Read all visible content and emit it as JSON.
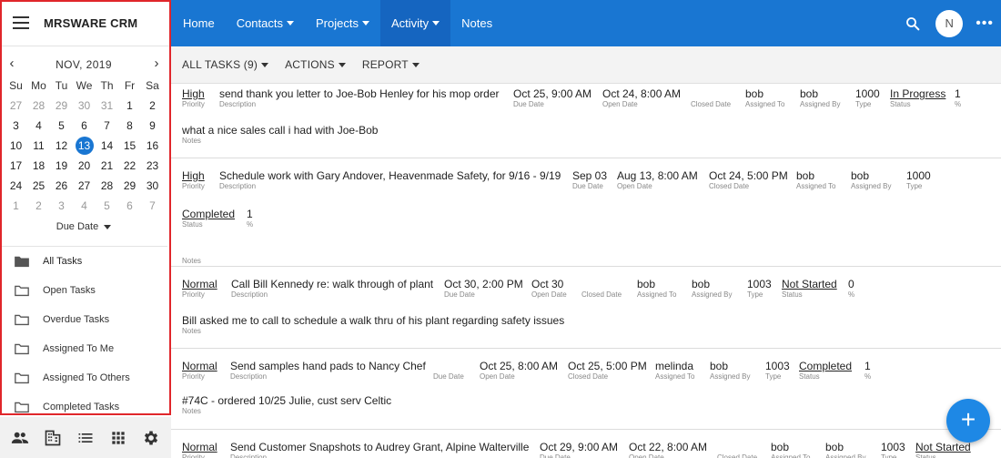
{
  "app": {
    "name": "MRSWARE CRM"
  },
  "calendar": {
    "title": "NOV, 2019",
    "weekdays": [
      "Su",
      "Mo",
      "Tu",
      "We",
      "Th",
      "Fr",
      "Sa"
    ],
    "weeks": [
      [
        "27",
        "28",
        "29",
        "30",
        "31",
        "1",
        "2"
      ],
      [
        "3",
        "4",
        "5",
        "6",
        "7",
        "8",
        "9"
      ],
      [
        "10",
        "11",
        "12",
        "13",
        "14",
        "15",
        "16"
      ],
      [
        "17",
        "18",
        "19",
        "20",
        "21",
        "22",
        "23"
      ],
      [
        "24",
        "25",
        "26",
        "27",
        "28",
        "29",
        "30"
      ],
      [
        "1",
        "2",
        "3",
        "4",
        "5",
        "6",
        "7"
      ]
    ],
    "today": "13",
    "sort_label": "Due Date"
  },
  "folders": [
    {
      "label": "All Tasks",
      "icon": "folder-filled-icon"
    },
    {
      "label": "Open Tasks",
      "icon": "folder-outline-icon"
    },
    {
      "label": "Overdue Tasks",
      "icon": "folder-outline-icon"
    },
    {
      "label": "Assigned To Me",
      "icon": "folder-outline-icon"
    },
    {
      "label": "Assigned To Others",
      "icon": "folder-outline-icon"
    },
    {
      "label": "Completed Tasks",
      "icon": "folder-outline-icon"
    }
  ],
  "bottom_icons": [
    "people-icon",
    "building-icon",
    "list-icon",
    "grid-icon",
    "gear-icon"
  ],
  "nav": {
    "home": "Home",
    "contacts": "Contacts",
    "projects": "Projects",
    "activity": "Activity",
    "notes": "Notes",
    "avatar_initial": "N"
  },
  "toolbar": {
    "all_tasks": "ALL TASKS (9)",
    "actions": "ACTIONS",
    "report": "REPORT"
  },
  "labels": {
    "priority": "Priority",
    "description": "Description",
    "due_date": "Due Date",
    "open_date": "Open Date",
    "closed_date": "Closed Date",
    "assigned_to": "Assigned To",
    "assigned_by": "Assigned By",
    "type": "Type",
    "status": "Status",
    "percent": "%",
    "notes": "Notes"
  },
  "tasks": [
    {
      "priority": "High",
      "description": "send thank you letter to Joe-Bob Henley for his mop order",
      "due_date": "Oct 25, 9:00 AM",
      "open_date": "Oct 24, 8:00 AM",
      "closed_date": "",
      "assigned_to": "bob",
      "assigned_by": "bob",
      "type": "1000",
      "status": "In Progress",
      "percent": "1",
      "notes": "what a nice sales call i had with Joe-Bob"
    },
    {
      "priority": "High",
      "description": "Schedule work with Gary Andover, Heavenmade Safety, for 9/16 - 9/19",
      "due_date": "Sep 03",
      "open_date": "Aug 13, 8:00 AM",
      "closed_date": "Oct 24, 5:00 PM",
      "assigned_to": "bob",
      "assigned_by": "bob",
      "type": "1000",
      "status": "Completed",
      "percent": "1",
      "notes": ""
    },
    {
      "priority": "Normal",
      "description": "Call Bill Kennedy re: walk through of plant",
      "due_date": "Oct 30, 2:00 PM",
      "open_date": "Oct 30",
      "closed_date": "",
      "assigned_to": "bob",
      "assigned_by": "bob",
      "type": "1003",
      "status": "Not Started",
      "percent": "0",
      "notes": "Bill asked me to call to schedule a walk thru of his plant regarding safety issues"
    },
    {
      "priority": "Normal",
      "description": "Send samples hand pads to Nancy Chef",
      "due_date": "",
      "open_date": "Oct 25, 8:00 AM",
      "closed_date": "Oct 25, 5:00 PM",
      "assigned_to": "melinda",
      "assigned_by": "bob",
      "type": "1003",
      "status": "Completed",
      "percent": "1",
      "notes": "#74C - ordered 10/25 Julie, cust serv Celtic"
    },
    {
      "priority": "Normal",
      "description": "Send Customer Snapshots to Audrey Grant, Alpine Walterville",
      "due_date": "Oct 29, 9:00 AM",
      "open_date": "Oct 22, 8:00 AM",
      "closed_date": "",
      "assigned_to": "bob",
      "assigned_by": "bob",
      "type": "1003",
      "status": "Not Started",
      "percent": "",
      "notes": ""
    }
  ],
  "colors": {
    "primary": "#1976d2",
    "active_nav": "#1565c0",
    "highlight": "#e0262b"
  }
}
